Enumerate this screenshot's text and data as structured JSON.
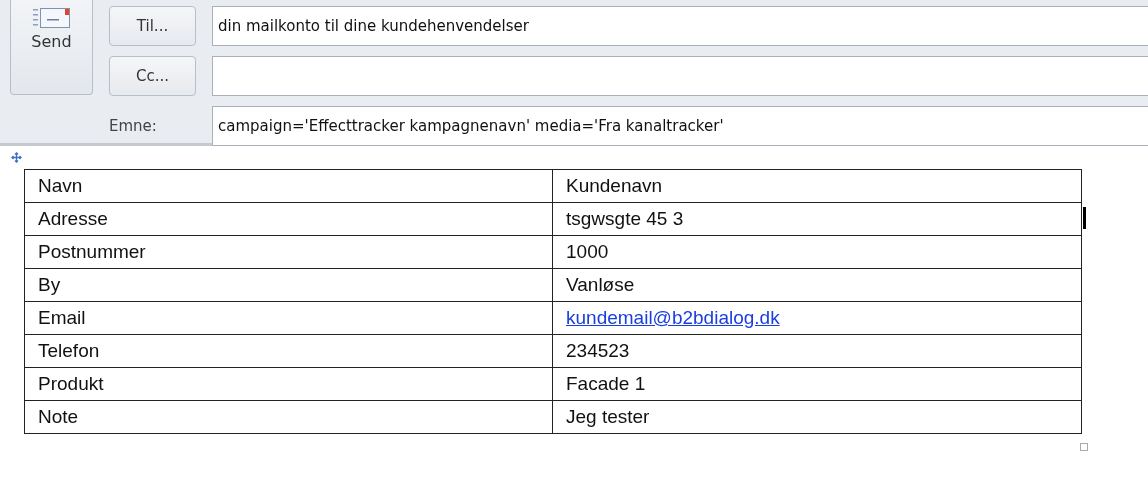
{
  "send_button": {
    "label": "Send"
  },
  "to_button": {
    "label": "Til..."
  },
  "to_field": {
    "value": "din mailkonto til dine kundehenvendelser"
  },
  "cc_button": {
    "label": "Cc..."
  },
  "subject_label": "Emne:",
  "subject_field": {
    "value": "campaign='Effecttracker kampagnenavn' media='Fra kanaltracker'"
  },
  "table": {
    "rows": [
      {
        "label": "Navn",
        "value": "Kundenavn",
        "kind": "text"
      },
      {
        "label": "Adresse",
        "value": "tsgwsgte 45 3",
        "kind": "text"
      },
      {
        "label": "Postnummer",
        "value": "1000",
        "kind": "text"
      },
      {
        "label": "By",
        "value": "Vanløse",
        "kind": "text"
      },
      {
        "label": "Email",
        "value": "kundemail@b2bdialog.dk",
        "kind": "link"
      },
      {
        "label": "Telefon",
        "value": "234523",
        "kind": "text"
      },
      {
        "label": "Produkt",
        "value": "Facade 1",
        "kind": "text"
      },
      {
        "label": "Note",
        "value": "Jeg tester",
        "kind": "text"
      }
    ]
  }
}
